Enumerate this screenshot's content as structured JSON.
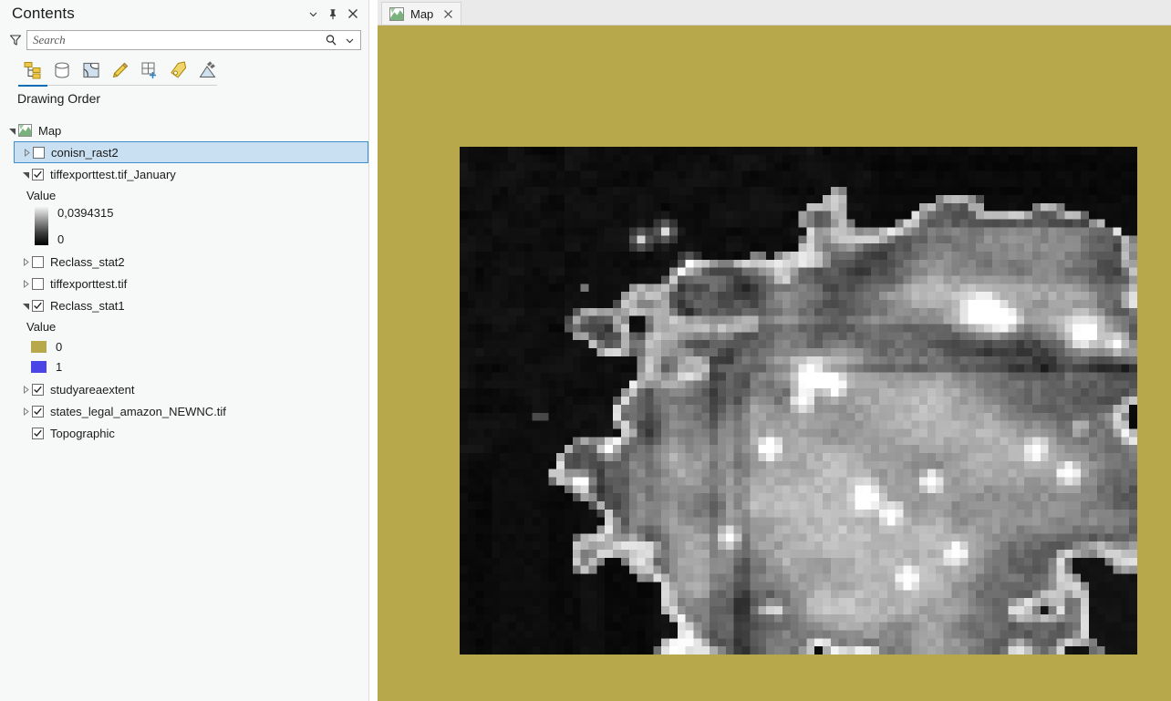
{
  "pane": {
    "title": "Contents",
    "titlebar_buttons": [
      {
        "name": "menu-chevron-icon",
        "glyph": "⌄"
      },
      {
        "name": "pin-icon",
        "glyph": "pin"
      },
      {
        "name": "close-icon",
        "glyph": "×"
      }
    ],
    "search": {
      "placeholder": "Search",
      "value": "",
      "filter_icon": "filter-funnel-icon",
      "search_icon": "magnifier-icon",
      "dropdown_icon": "chevron-down-icon"
    },
    "toolbar": {
      "icons": [
        {
          "name": "list-by-drawing-order-icon",
          "active": true
        },
        {
          "name": "list-by-data-source-icon",
          "active": false
        },
        {
          "name": "list-by-selection-icon",
          "active": false
        },
        {
          "name": "list-by-editing-icon",
          "active": false
        },
        {
          "name": "list-by-snapping-icon",
          "active": false
        },
        {
          "name": "list-by-labeling-icon",
          "active": false
        },
        {
          "name": "list-by-charts-icon",
          "active": false
        }
      ]
    },
    "heading": "Drawing Order"
  },
  "tree": {
    "root": {
      "label": "Map",
      "expanded": true,
      "icon": "map-thumbnail-icon"
    },
    "layers": [
      {
        "label": "conisn_rast2",
        "checked": false,
        "expanded": false,
        "selected": true,
        "indent": 1
      },
      {
        "label": "tiffexporttest.tif_January",
        "checked": true,
        "expanded": true,
        "selected": false,
        "indent": 1,
        "legend": {
          "heading": "Value",
          "type": "continuous",
          "max": "0,0394315",
          "min": "0",
          "ramp_top_color": "#ffffff",
          "ramp_bottom_color": "#000000"
        }
      },
      {
        "label": "Reclass_stat2",
        "checked": false,
        "expanded": false,
        "selected": false,
        "indent": 1
      },
      {
        "label": "tiffexporttest.tif",
        "checked": false,
        "expanded": false,
        "selected": false,
        "indent": 1
      },
      {
        "label": "Reclass_stat1",
        "checked": true,
        "expanded": true,
        "selected": false,
        "indent": 1,
        "legend": {
          "heading": "Value",
          "type": "unique",
          "classes": [
            {
              "color": "#b8a84c",
              "label": "0"
            },
            {
              "color": "#4b45e8",
              "label": "1"
            }
          ]
        }
      },
      {
        "label": "studyareaextent",
        "checked": true,
        "expanded": false,
        "selected": false,
        "indent": 1
      },
      {
        "label": "states_legal_amazon_NEWNC.tif",
        "checked": true,
        "expanded": false,
        "selected": false,
        "indent": 1
      },
      {
        "label": "Topographic",
        "checked": true,
        "expanded": null,
        "selected": false,
        "indent": 1
      }
    ]
  },
  "map": {
    "tab": {
      "label": "Map",
      "icon": "map-thumbnail-icon",
      "close_icon": "close-icon"
    },
    "background_color": "#b8a84c",
    "raster": {
      "name": "grayscale-nightlights-raster",
      "description": "pixelated grayscale raster",
      "min_color": "#000000",
      "max_color": "#ffffff"
    }
  },
  "colors": {
    "selection_fill": "#c9e0f2",
    "selection_border": "#3d8fcd",
    "accent": "#0a6cb4",
    "pane_bg": "#f7f8f8",
    "tabstrip_bg": "#eaeaea"
  }
}
